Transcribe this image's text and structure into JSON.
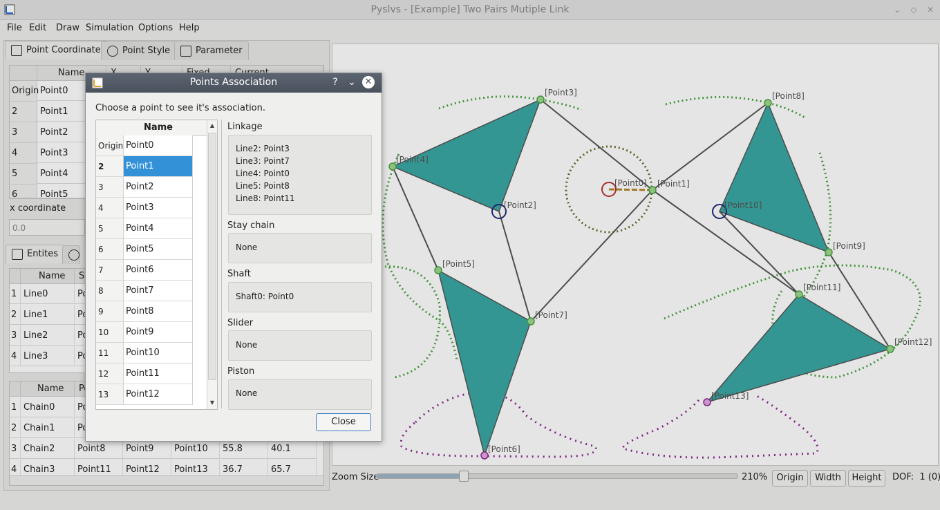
{
  "window": {
    "title": "Pyslvs - [Example] Two Pairs Mutiple Link"
  },
  "menu": [
    "File",
    "Edit",
    "Draw",
    "Simulation",
    "Options",
    "Help"
  ],
  "left_tabs": [
    "Point Coordinate",
    "Point Style",
    "Parameter"
  ],
  "points_table": {
    "headers": [
      "Name",
      "X",
      "Y",
      "Fixed",
      "Current"
    ],
    "rows": [
      {
        "id": "Origin",
        "name": "Point0"
      },
      {
        "id": "2",
        "name": "Point1"
      },
      {
        "id": "3",
        "name": "Point2"
      },
      {
        "id": "4",
        "name": "Point3"
      },
      {
        "id": "5",
        "name": "Point4"
      },
      {
        "id": "6",
        "name": "Point5"
      }
    ]
  },
  "x_coordinate": {
    "label": "x coordinate",
    "value": "0.0"
  },
  "entities_tab": "Entites",
  "lines_table": {
    "headers": [
      "Name",
      "St"
    ],
    "rows": [
      {
        "id": "1",
        "name": "Line0",
        "pt": "Poi"
      },
      {
        "id": "2",
        "name": "Line1",
        "pt": "Poi"
      },
      {
        "id": "3",
        "name": "Line2",
        "pt": "Poi"
      },
      {
        "id": "4",
        "name": "Line3",
        "pt": "Poi"
      }
    ]
  },
  "chains_table": {
    "headers": [
      "Name",
      "Po"
    ],
    "rows": [
      {
        "id": "1",
        "name": "Chain0",
        "p1": "Poin",
        "p2": "",
        "p3": "",
        "a": "",
        "b": ""
      },
      {
        "id": "2",
        "name": "Chain1",
        "p1": "Poin",
        "p2": "",
        "p3": "",
        "a": "",
        "b": ""
      },
      {
        "id": "3",
        "name": "Chain2",
        "p1": "Point8",
        "p2": "Point9",
        "p3": "Point10",
        "a": "55.8",
        "b": "40.1"
      },
      {
        "id": "4",
        "name": "Chain3",
        "p1": "Point11",
        "p2": "Point12",
        "p3": "Point13",
        "a": "36.7",
        "b": "65.7"
      }
    ]
  },
  "canvas_labels": [
    "[Point0]",
    "[Point1]",
    "[Point2]",
    "[Point3]",
    "[Point4]",
    "[Point5]",
    "[Point6]",
    "[Point7]",
    "[Point8]",
    "[Point9]",
    "[Point10]",
    "[Point11]",
    "[Point12]",
    "[Point13]"
  ],
  "zoom": {
    "label": "Zoom Size",
    "value": "210%",
    "fraction": 0.24
  },
  "bottom_buttons": {
    "origin": "Origin",
    "width": "Width",
    "height": "Height"
  },
  "dof": "DOF:  1 (0)",
  "dialog": {
    "title": "Points Association",
    "prompt": "Choose a point to see it's association.",
    "list_header": "Name",
    "list": [
      {
        "id": "Origin",
        "name": "Point0"
      },
      {
        "id": "2",
        "name": "Point1"
      },
      {
        "id": "3",
        "name": "Point2"
      },
      {
        "id": "4",
        "name": "Point3"
      },
      {
        "id": "5",
        "name": "Point4"
      },
      {
        "id": "6",
        "name": "Point5"
      },
      {
        "id": "7",
        "name": "Point6"
      },
      {
        "id": "8",
        "name": "Point7"
      },
      {
        "id": "9",
        "name": "Point8"
      },
      {
        "id": "10",
        "name": "Point9"
      },
      {
        "id": "11",
        "name": "Point10"
      },
      {
        "id": "12",
        "name": "Point11"
      },
      {
        "id": "13",
        "name": "Point12"
      }
    ],
    "selected_index": 1,
    "groups": {
      "linkage": {
        "label": "Linkage",
        "lines": [
          "Line2: Point3",
          "Line3: Point7",
          "Line4: Point0",
          "Line5: Point8",
          "Line8: Point11"
        ]
      },
      "stay_chain": {
        "label": "Stay chain",
        "value": "None"
      },
      "shaft": {
        "label": "Shaft",
        "value": "Shaft0: Point0"
      },
      "slider": {
        "label": "Slider",
        "value": "None"
      },
      "piston": {
        "label": "Piston",
        "value": "None"
      }
    },
    "close_label": "Close"
  },
  "colors": {
    "link_fill": "#3aa7a3",
    "path_green": "#4aa540",
    "path_purple": "#8e2a8e",
    "selection": "#3391d8"
  }
}
